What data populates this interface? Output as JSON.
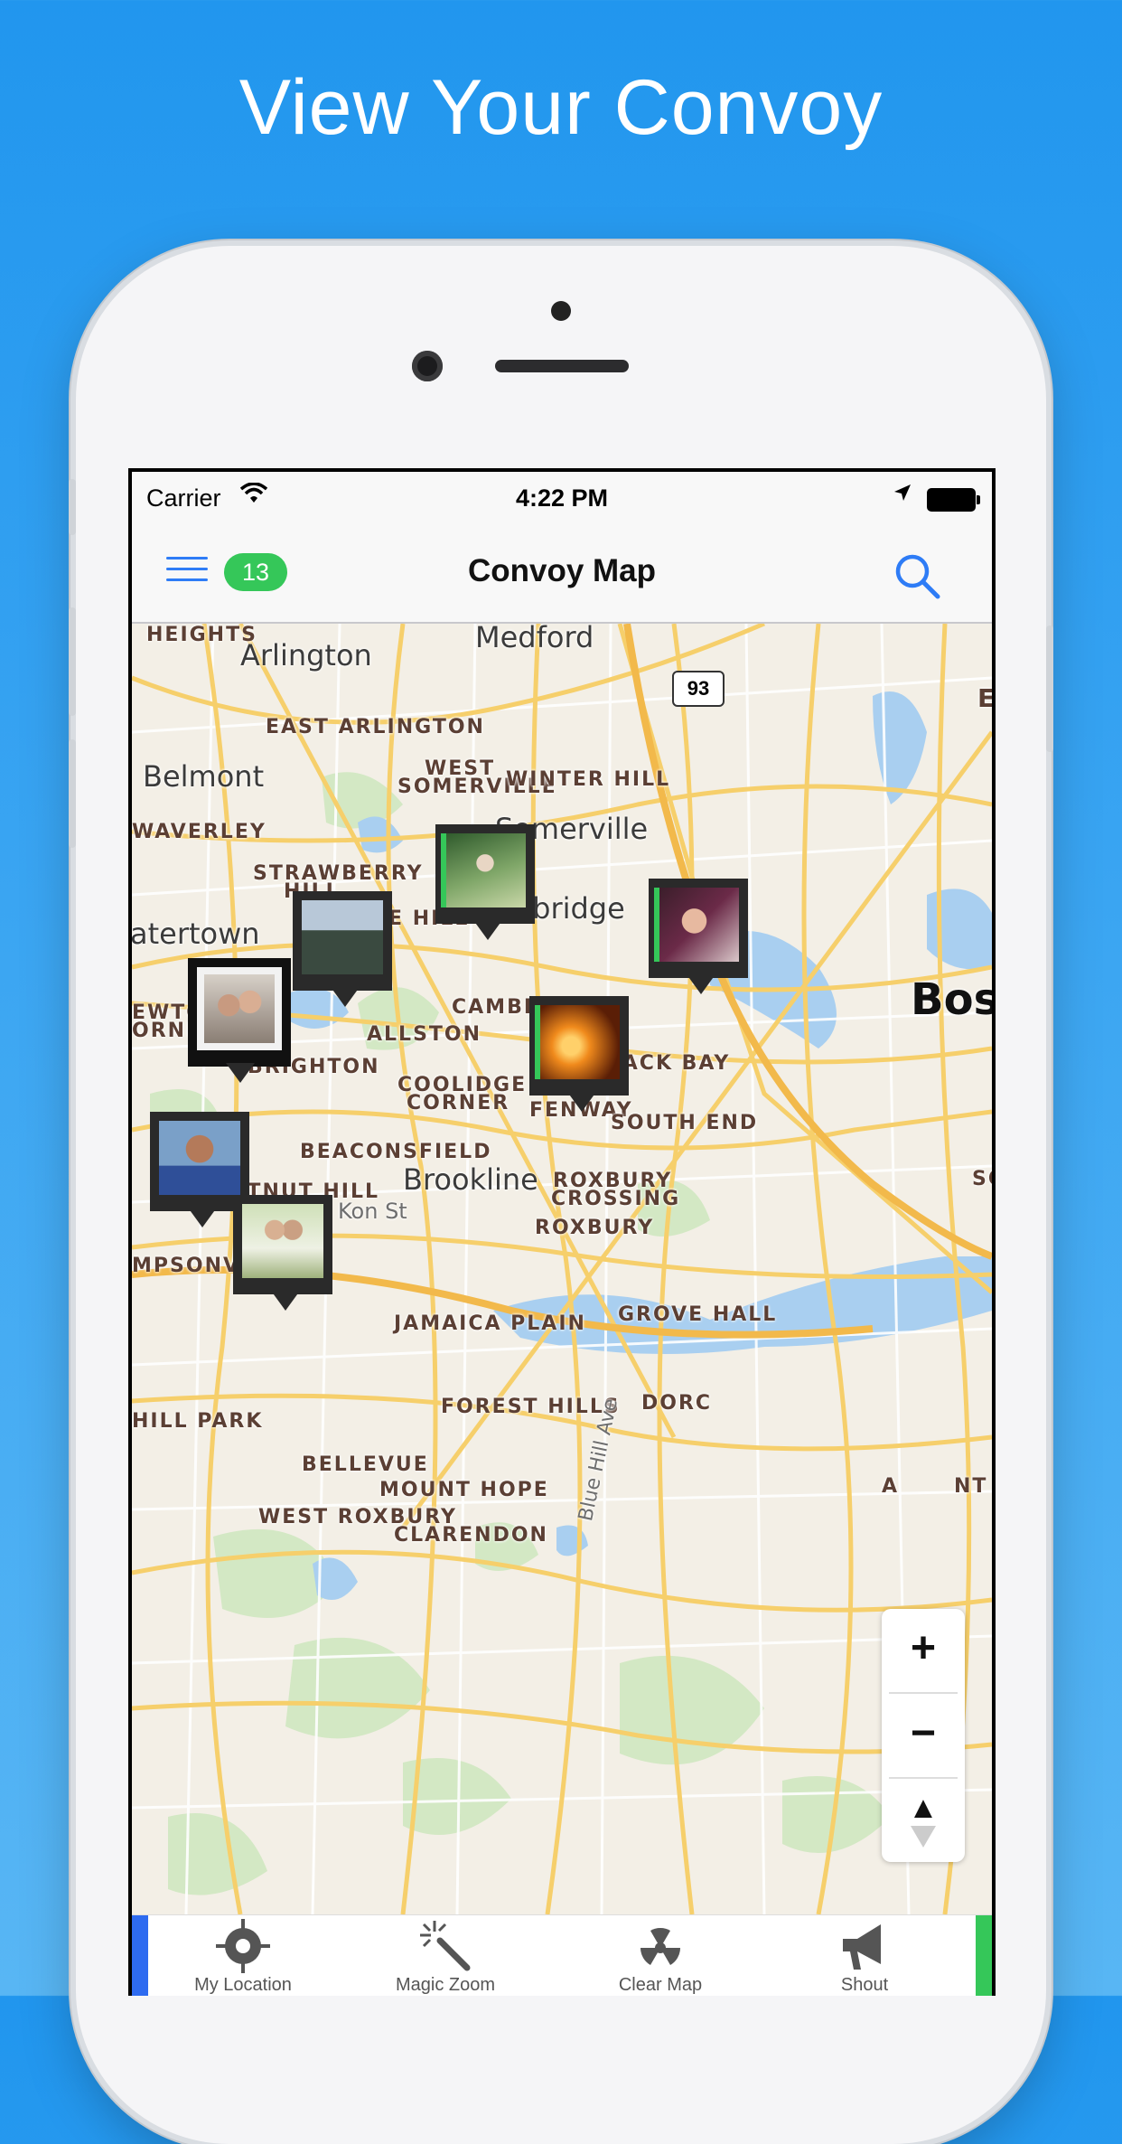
{
  "headline": "View Your Convoy",
  "status_bar": {
    "carrier": "Carrier",
    "time": "4:22 PM"
  },
  "nav": {
    "title": "Convoy Map",
    "badge_count": "13"
  },
  "map": {
    "route_shield": "93",
    "cities": [
      {
        "text": "Medford"
      },
      {
        "text": "Arlington"
      },
      {
        "text": "Belmont"
      },
      {
        "text": "Somerville"
      },
      {
        "text": "Cambridge"
      },
      {
        "text": "atertown"
      },
      {
        "text": "Brookline"
      },
      {
        "text": "Bos"
      },
      {
        "text": "Kon St"
      }
    ],
    "neighborhoods": [
      {
        "text": "HEIGHTS"
      },
      {
        "text": "EAST ARLINGTON"
      },
      {
        "text": "WEST"
      },
      {
        "text": "SOMERVILLE"
      },
      {
        "text": "WINTER HILL"
      },
      {
        "text": "WAVERLEY"
      },
      {
        "text": "STRAWBERRY"
      },
      {
        "text": "HILL"
      },
      {
        "text": "GE HILL"
      },
      {
        "text": "EWTON"
      },
      {
        "text": "ORNER"
      },
      {
        "text": "CAMBRIDG"
      },
      {
        "text": "ALLSTON"
      },
      {
        "text": "BRIGHTON"
      },
      {
        "text": "BACK BAY"
      },
      {
        "text": "COOLIDGE"
      },
      {
        "text": "CORNER"
      },
      {
        "text": "FENWAY"
      },
      {
        "text": "SOUTH END"
      },
      {
        "text": "BEACONSFIELD"
      },
      {
        "text": "CHESTNUT HILL"
      },
      {
        "text": "ROXBURY"
      },
      {
        "text": "CROSSING"
      },
      {
        "text": "ROXBURY"
      },
      {
        "text": "MPSONVILLE"
      },
      {
        "text": "JAMAICA PLAIN"
      },
      {
        "text": "GROVE HALL"
      },
      {
        "text": "FOREST HILLS"
      },
      {
        "text": "DORC"
      },
      {
        "text": "HILL PARK"
      },
      {
        "text": "BELLEVUE"
      },
      {
        "text": "MOUNT HOPE"
      },
      {
        "text": "WEST ROXBURY"
      },
      {
        "text": "CLARENDON"
      },
      {
        "text": "SO"
      },
      {
        "text": "A"
      },
      {
        "text": "NT"
      },
      {
        "text": "E"
      }
    ],
    "road_label": "Blue Hill Ave",
    "zoom_in": "+",
    "zoom_out": "−",
    "compass": "▲"
  },
  "tabs": [
    {
      "label": "My Location",
      "icon": "crosshair-icon"
    },
    {
      "label": "Magic Zoom",
      "icon": "magic-wand-icon"
    },
    {
      "label": "Clear Map",
      "icon": "radiation-icon"
    },
    {
      "label": "Shout",
      "icon": "megaphone-icon"
    }
  ],
  "colors": {
    "accent": "#2e7cf6",
    "badge": "#35c759",
    "background": "#2196ee"
  }
}
